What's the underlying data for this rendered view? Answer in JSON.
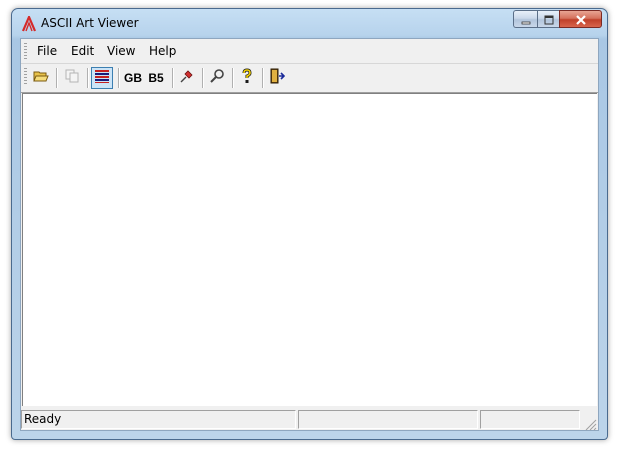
{
  "window": {
    "title": "ASCII Art Viewer",
    "icon": "ascii-art-app-icon"
  },
  "caption_buttons": {
    "minimize_icon": "minimize-icon",
    "maximize_icon": "maximize-icon",
    "close_icon": "close-icon"
  },
  "menubar": {
    "items": [
      {
        "label": "File"
      },
      {
        "label": "Edit"
      },
      {
        "label": "View"
      },
      {
        "label": "Help"
      }
    ]
  },
  "toolbar": {
    "buttons": [
      {
        "icon": "open-folder-icon",
        "state": "enabled"
      },
      {
        "icon": "copy-icon",
        "state": "disabled"
      },
      {
        "icon": "text-lines-icon",
        "state": "pressed"
      },
      {
        "label": "GB",
        "state": "enabled"
      },
      {
        "label": "B5",
        "state": "enabled"
      },
      {
        "icon": "pin-icon",
        "state": "enabled"
      },
      {
        "icon": "tools-icon",
        "state": "enabled"
      },
      {
        "icon": "help-question-icon",
        "state": "enabled"
      },
      {
        "icon": "exit-door-icon",
        "state": "enabled"
      }
    ]
  },
  "statusbar": {
    "panes": [
      {
        "text": "Ready"
      },
      {
        "text": ""
      },
      {
        "text": ""
      }
    ]
  },
  "colors": {
    "accent_pressed": "#cce4f7",
    "title_bar": "#b7d3ec",
    "close_button": "#c0402a"
  }
}
